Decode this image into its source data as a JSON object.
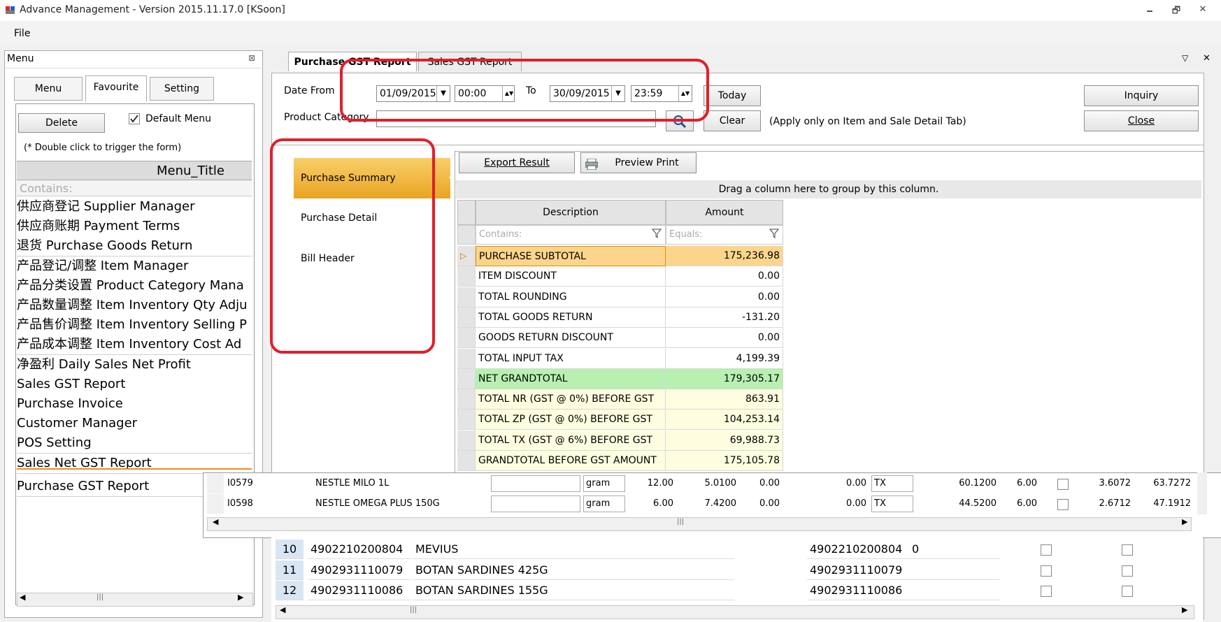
{
  "window": {
    "title": "Advance Management - Version 2015.11.17.0 [KSoon]",
    "min": "🗕",
    "restore": "🗗",
    "close": "✕"
  },
  "menubar": {
    "file": "File"
  },
  "left_panel": {
    "header": "Menu",
    "pin": "⊠",
    "tabs": [
      "Menu",
      "Favourite",
      "Setting"
    ],
    "delete_label": "Delete",
    "default_menu_label": "Default Menu",
    "default_menu_checked": true,
    "hint": "(* Double click to trigger the form)",
    "column_title": "Menu_Title",
    "filter_placeholder": "Contains:",
    "items": [
      "供应商登记 Supplier Manager",
      "供应商账期 Payment Terms",
      "退货 Purchase Goods Return",
      "产品登记/调整 Item Manager",
      "产品分类设置 Product Category Mana",
      "产品数量调整 Item Inventory Qty Adju",
      "产品售价调整 Item Inventory Selling P",
      "产品成本调整 Item Inventory Cost Ad",
      "净盈利 Daily Sales Net Profit",
      "Sales GST Report",
      "Purchase Invoice",
      "Customer Manager",
      "POS Setting",
      "Sales Net GST Report",
      "Purchase GST Report"
    ],
    "scroll_grip": "|||"
  },
  "report": {
    "tabs": [
      "Purchase GST Report",
      "Sales GST Report"
    ],
    "pane_menu": "▽",
    "pane_close": "✕",
    "date_from_label": "Date From",
    "date_from": "01/09/2015",
    "time_from": "00:00",
    "to_label": "To",
    "date_to": "30/09/2015",
    "time_to": "23:59",
    "today_label": "Today",
    "clear_label": "Clear",
    "note": "(Apply only on Item and Sale Detail Tab)",
    "product_category_label": "Product Category",
    "product_category_value": "",
    "inquiry_label": "Inquiry",
    "close_label": "Close",
    "side_tabs": [
      "Purchase Summary",
      "Purchase Detail",
      "Bill Header"
    ],
    "export_label": "Export Result",
    "preview_label": "Preview Print",
    "group_hint": "Drag a column here to group by this column.",
    "columns": [
      "Description",
      "Amount"
    ],
    "filter_desc": "Contains:",
    "filter_amt": "Equals:",
    "rows": [
      {
        "desc": "PURCHASE SUBTOTAL",
        "amount": "175,236.98"
      },
      {
        "desc": "ITEM DISCOUNT",
        "amount": "0.00"
      },
      {
        "desc": "TOTAL ROUNDING",
        "amount": "0.00"
      },
      {
        "desc": "TOTAL GOODS RETURN",
        "amount": "-131.20"
      },
      {
        "desc": "GOODS RETURN DISCOUNT",
        "amount": "0.00"
      },
      {
        "desc": "TOTAL INPUT TAX",
        "amount": "4,199.39"
      },
      {
        "desc": "NET GRANDTOTAL",
        "amount": "179,305.17"
      },
      {
        "desc": "TOTAL NR (GST @ 0%) BEFORE GST",
        "amount": "863.91"
      },
      {
        "desc": "TOTAL ZP (GST @ 0%) BEFORE GST",
        "amount": "104,253.14"
      },
      {
        "desc": "TOTAL TX (GST @ 6%) BEFORE GST",
        "amount": "69,988.73"
      },
      {
        "desc": "GRANDTOTAL BEFORE GST AMOUNT",
        "amount": "175,105.78"
      }
    ],
    "colors": {
      "selected_row": "#fcd58c",
      "green_row": "#b7f0b1",
      "yellow_row": "#fdfde0",
      "side_active": "#f3b33b",
      "highlight": "#e0202a"
    }
  },
  "overlay_items": {
    "rows": [
      {
        "code": "I0579",
        "name": "NESTLE MILO 1L",
        "unit": "gram",
        "qty": "12.00",
        "price": "5.0100",
        "disc": "0.00",
        "amt": "0.00",
        "tax": "TX",
        "total": "60.1200",
        "rate": "6.00",
        "gst": "3.6072",
        "net": "63.7272"
      },
      {
        "code": "I0598",
        "name": "NESTLE OMEGA PLUS 150G",
        "unit": "gram",
        "qty": "6.00",
        "price": "7.4200",
        "disc": "0.00",
        "amt": "0.00",
        "tax": "TX",
        "total": "44.5200",
        "rate": "6.00",
        "gst": "2.6712",
        "net": "47.1912"
      }
    ],
    "scroll_grip": "|||"
  },
  "overlay_products": {
    "rows": [
      {
        "no": "10",
        "barcode": "4902210200804",
        "name": "MEVIUS",
        "barcode2": "4902210200804",
        "extra": "0"
      },
      {
        "no": "11",
        "barcode": "4902931110079",
        "name": "BOTAN SARDINES 425G",
        "barcode2": "4902931110079",
        "extra": ""
      },
      {
        "no": "12",
        "barcode": "4902931110086",
        "name": "BOTAN SARDINES 155G",
        "barcode2": "4902931110086",
        "extra": ""
      }
    ],
    "scroll_grip": "|||"
  }
}
